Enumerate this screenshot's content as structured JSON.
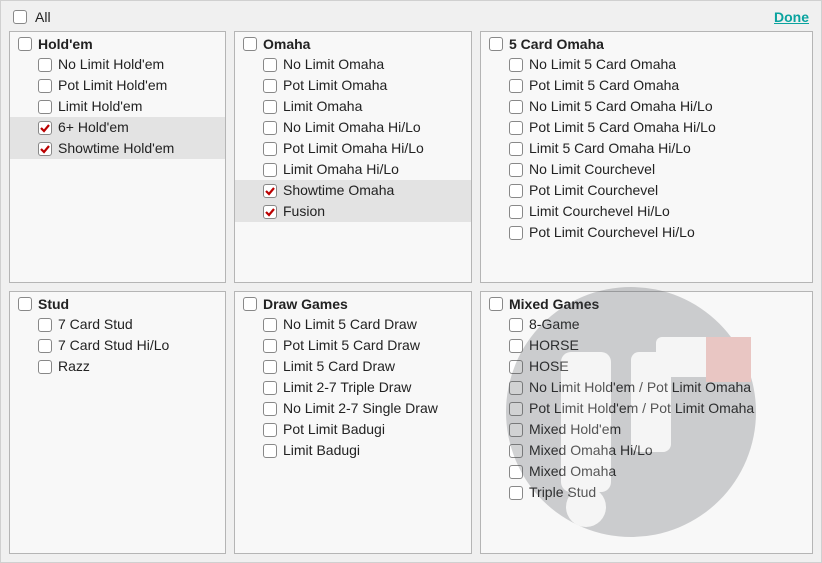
{
  "header": {
    "all_label": "All",
    "done_label": "Done"
  },
  "groups": [
    {
      "id": "holdem",
      "title": "Hold'em",
      "col": 1,
      "row": 1,
      "items": [
        {
          "label": "No Limit Hold'em",
          "checked": false
        },
        {
          "label": "Pot Limit Hold'em",
          "checked": false
        },
        {
          "label": "Limit Hold'em",
          "checked": false
        },
        {
          "label": "6+ Hold'em",
          "checked": true
        },
        {
          "label": "Showtime Hold'em",
          "checked": true
        }
      ]
    },
    {
      "id": "omaha",
      "title": "Omaha",
      "col": 2,
      "row": 1,
      "items": [
        {
          "label": "No Limit Omaha",
          "checked": false
        },
        {
          "label": "Pot Limit Omaha",
          "checked": false
        },
        {
          "label": "Limit Omaha",
          "checked": false
        },
        {
          "label": "No Limit Omaha Hi/Lo",
          "checked": false
        },
        {
          "label": "Pot Limit Omaha Hi/Lo",
          "checked": false
        },
        {
          "label": "Limit Omaha Hi/Lo",
          "checked": false
        },
        {
          "label": "Showtime Omaha",
          "checked": true
        },
        {
          "label": "Fusion",
          "checked": true
        }
      ]
    },
    {
      "id": "fivecard-omaha",
      "title": "5 Card Omaha",
      "col": 3,
      "row": 1,
      "items": [
        {
          "label": "No Limit 5 Card Omaha",
          "checked": false
        },
        {
          "label": "Pot Limit 5 Card Omaha",
          "checked": false
        },
        {
          "label": "No Limit 5 Card Omaha Hi/Lo",
          "checked": false
        },
        {
          "label": "Pot Limit 5 Card Omaha Hi/Lo",
          "checked": false
        },
        {
          "label": "Limit 5 Card Omaha Hi/Lo",
          "checked": false
        },
        {
          "label": "No Limit Courchevel",
          "checked": false
        },
        {
          "label": "Pot Limit Courchevel",
          "checked": false
        },
        {
          "label": "Limit Courchevel Hi/Lo",
          "checked": false
        },
        {
          "label": "Pot Limit Courchevel Hi/Lo",
          "checked": false
        }
      ]
    },
    {
      "id": "stud",
      "title": "Stud",
      "col": 1,
      "row": 2,
      "items": [
        {
          "label": "7 Card Stud",
          "checked": false
        },
        {
          "label": "7 Card Stud Hi/Lo",
          "checked": false
        },
        {
          "label": "Razz",
          "checked": false
        }
      ]
    },
    {
      "id": "draw-games",
      "title": "Draw Games",
      "col": 2,
      "row": 2,
      "items": [
        {
          "label": "No Limit 5 Card Draw",
          "checked": false
        },
        {
          "label": "Pot Limit 5 Card Draw",
          "checked": false
        },
        {
          "label": "Limit 5 Card Draw",
          "checked": false
        },
        {
          "label": "Limit 2-7 Triple Draw",
          "checked": false
        },
        {
          "label": "No Limit 2-7 Single Draw",
          "checked": false
        },
        {
          "label": "Pot Limit Badugi",
          "checked": false
        },
        {
          "label": "Limit Badugi",
          "checked": false
        }
      ]
    },
    {
      "id": "mixed-games",
      "title": "Mixed Games",
      "col": 3,
      "row": 2,
      "items": [
        {
          "label": "8-Game",
          "checked": false
        },
        {
          "label": "HORSE",
          "checked": false
        },
        {
          "label": "HOSE",
          "checked": false
        },
        {
          "label": "No Limit Hold'em / Pot Limit Omaha",
          "checked": false
        },
        {
          "label": "Pot Limit Hold'em / Pot Limit Omaha",
          "checked": false
        },
        {
          "label": "Mixed Hold'em",
          "checked": false
        },
        {
          "label": "Mixed Omaha Hi/Lo",
          "checked": false
        },
        {
          "label": "Mixed Omaha",
          "checked": false
        },
        {
          "label": "Triple Stud",
          "checked": false
        }
      ]
    }
  ]
}
